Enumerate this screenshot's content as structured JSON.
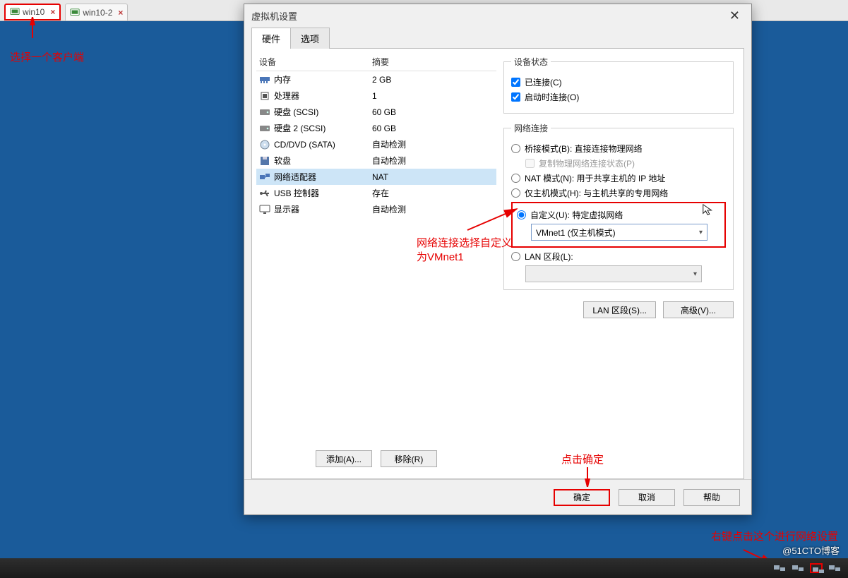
{
  "tabs": {
    "t1": "win10",
    "t2": "win10-2"
  },
  "notes": {
    "select_client": "选择一个客户端",
    "net_note": "网络连接选择自定义\n为VMnet1",
    "ok_note": "点击确定",
    "tray_note": "右键点击这个进行网络设置"
  },
  "dialog": {
    "title": "虚拟机设置",
    "tab_hw": "硬件",
    "tab_opt": "选项",
    "head_dev": "设备",
    "head_sum": "摘要",
    "devices": [
      {
        "name": "内存",
        "sum": "2 GB"
      },
      {
        "name": "处理器",
        "sum": "1"
      },
      {
        "name": "硬盘 (SCSI)",
        "sum": "60 GB"
      },
      {
        "name": "硬盘 2 (SCSI)",
        "sum": "60 GB"
      },
      {
        "name": "CD/DVD (SATA)",
        "sum": "自动检测"
      },
      {
        "name": "软盘",
        "sum": "自动检测"
      },
      {
        "name": "网络适配器",
        "sum": "NAT"
      },
      {
        "name": "USB 控制器",
        "sum": "存在"
      },
      {
        "name": "显示器",
        "sum": "自动检测"
      }
    ],
    "btn_add": "添加(A)...",
    "btn_remove": "移除(R)",
    "grp_state": "设备状态",
    "chk_connected": "已连接(C)",
    "chk_on_start": "启动时连接(O)",
    "grp_net": "网络连接",
    "rdo_bridge": "桥接模式(B): 直接连接物理网络",
    "chk_replicate": "复制物理网络连接状态(P)",
    "rdo_nat": "NAT 模式(N): 用于共享主机的 IP 地址",
    "rdo_host": "仅主机模式(H): 与主机共享的专用网络",
    "rdo_custom": "自定义(U): 特定虚拟网络",
    "combo_custom": "VMnet1 (仅主机模式)",
    "rdo_lan": "LAN 区段(L):",
    "btn_lan": "LAN 区段(S)...",
    "btn_adv": "高级(V)...",
    "btn_ok": "确定",
    "btn_cancel": "取消",
    "btn_help": "帮助"
  },
  "watermark": "@51CTO博客"
}
